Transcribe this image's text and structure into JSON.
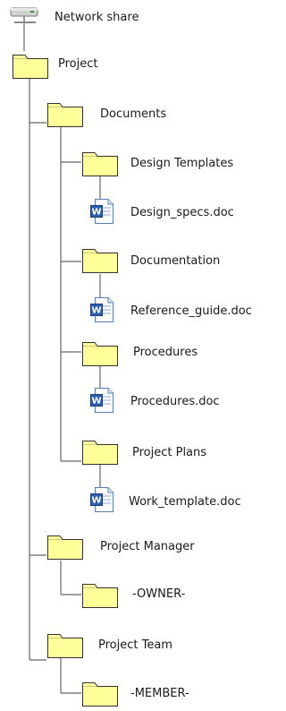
{
  "tree": {
    "root": {
      "label": "Network share",
      "icon": "network-drive-icon"
    },
    "nodes": [
      {
        "label": "Project",
        "icon": "folder-icon"
      },
      {
        "label": "Documents",
        "icon": "folder-icon"
      },
      {
        "label": "Design Templates",
        "icon": "folder-icon"
      },
      {
        "label": "Design_specs.doc",
        "icon": "word-document-icon"
      },
      {
        "label": "Documentation",
        "icon": "folder-icon"
      },
      {
        "label": "Reference_guide.doc",
        "icon": "word-document-icon"
      },
      {
        "label": "Procedures",
        "icon": "folder-icon"
      },
      {
        "label": "Procedures.doc",
        "icon": "word-document-icon"
      },
      {
        "label": "Project Plans",
        "icon": "folder-icon"
      },
      {
        "label": "Work_template.doc",
        "icon": "word-document-icon"
      },
      {
        "label": "Project Manager",
        "icon": "folder-icon"
      },
      {
        "label": "-OWNER-",
        "icon": "folder-icon"
      },
      {
        "label": "Project Team",
        "icon": "folder-icon"
      },
      {
        "label": "-MEMBER-",
        "icon": "folder-icon"
      }
    ],
    "colors": {
      "folder_fill": "#ffff99",
      "folder_stroke": "#333333",
      "connector": "#666666",
      "doc_blue": "#2b5fb4"
    }
  }
}
